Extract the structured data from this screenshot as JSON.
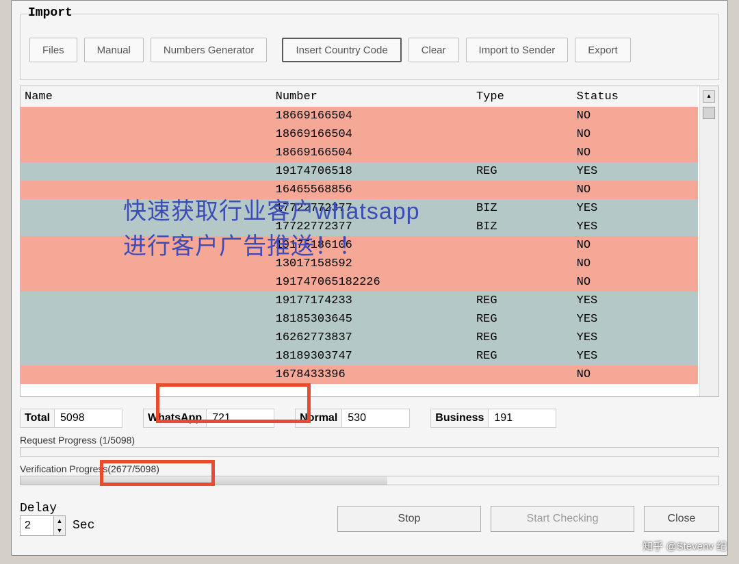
{
  "import": {
    "legend": "Import",
    "buttons": {
      "files": "Files",
      "manual": "Manual",
      "numgen": "Numbers Generator",
      "insert_cc": "Insert Country Code",
      "clear": "Clear",
      "import_sender": "Import to Sender",
      "export": "Export"
    }
  },
  "table": {
    "headers": {
      "name": "Name",
      "number": "Number",
      "type": "Type",
      "status": "Status"
    },
    "rows": [
      {
        "name": "",
        "number": "18669166504",
        "type": "",
        "status": "NO"
      },
      {
        "name": "",
        "number": "18669166504",
        "type": "",
        "status": "NO"
      },
      {
        "name": "",
        "number": "18669166504",
        "type": "",
        "status": "NO"
      },
      {
        "name": "",
        "number": "19174706518",
        "type": "REG",
        "status": "YES"
      },
      {
        "name": "",
        "number": "16465568856",
        "type": "",
        "status": "NO"
      },
      {
        "name": "",
        "number": "17722772377",
        "type": "BIZ",
        "status": "YES"
      },
      {
        "name": "",
        "number": "17722772377",
        "type": "BIZ",
        "status": "YES"
      },
      {
        "name": "",
        "number": "19175186106",
        "type": "",
        "status": "NO"
      },
      {
        "name": "",
        "number": "13017158592",
        "type": "",
        "status": "NO"
      },
      {
        "name": "",
        "number": "191747065182226",
        "type": "",
        "status": "NO"
      },
      {
        "name": "",
        "number": "19177174233",
        "type": "REG",
        "status": "YES"
      },
      {
        "name": "",
        "number": "18185303645",
        "type": "REG",
        "status": "YES"
      },
      {
        "name": "",
        "number": "16262773837",
        "type": "REG",
        "status": "YES"
      },
      {
        "name": "",
        "number": "18189303747",
        "type": "REG",
        "status": "YES"
      },
      {
        "name": "",
        "number": "1678433396",
        "type": "",
        "status": "NO"
      }
    ]
  },
  "stats": {
    "total_label": "Total",
    "total": "5098",
    "whatsapp_label": "WhatsApp",
    "whatsapp": "721",
    "normal_label": "Normal",
    "normal": "530",
    "business_label": "Business",
    "business": "191"
  },
  "progress": {
    "request_label": "Request Progress (1/5098)",
    "verify_label": "Verification Progress(2677/5098)",
    "request_pct": 0.02,
    "verify_pct": 52.5
  },
  "delay": {
    "legend": "Delay",
    "value": "2",
    "unit": "Sec"
  },
  "actions": {
    "stop": "Stop",
    "start": "Start Checking",
    "close": "Close"
  },
  "overlay": {
    "line1": "快速获取行业客户whatsapp",
    "line2": "进行客户广告推送！！"
  },
  "watermark": "知乎 @Stevenv 纪"
}
